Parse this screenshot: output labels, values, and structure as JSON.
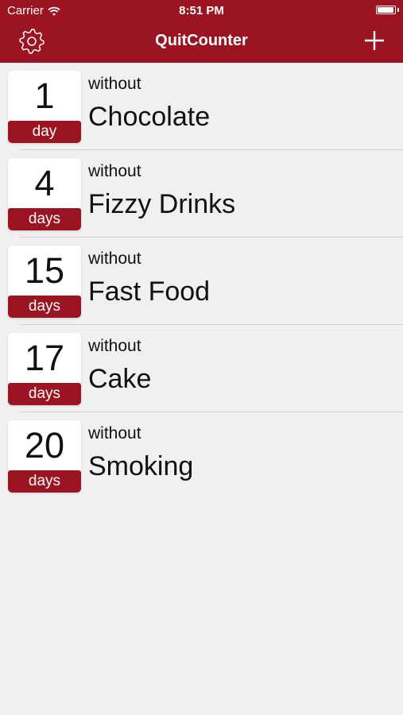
{
  "status_bar": {
    "carrier": "Carrier",
    "time": "8:51 PM",
    "battery_level": 0.95
  },
  "nav": {
    "title": "QuitCounter",
    "settings_icon": "gear-icon",
    "add_icon": "plus-icon"
  },
  "colors": {
    "accent": "#9a1421",
    "background": "#f0f0f0"
  },
  "items": [
    {
      "count": "1",
      "unit": "day",
      "prefix": "without",
      "name": "Chocolate"
    },
    {
      "count": "4",
      "unit": "days",
      "prefix": "without",
      "name": "Fizzy Drinks"
    },
    {
      "count": "15",
      "unit": "days",
      "prefix": "without",
      "name": "Fast Food"
    },
    {
      "count": "17",
      "unit": "days",
      "prefix": "without",
      "name": "Cake"
    },
    {
      "count": "20",
      "unit": "days",
      "prefix": "without",
      "name": "Smoking"
    }
  ]
}
